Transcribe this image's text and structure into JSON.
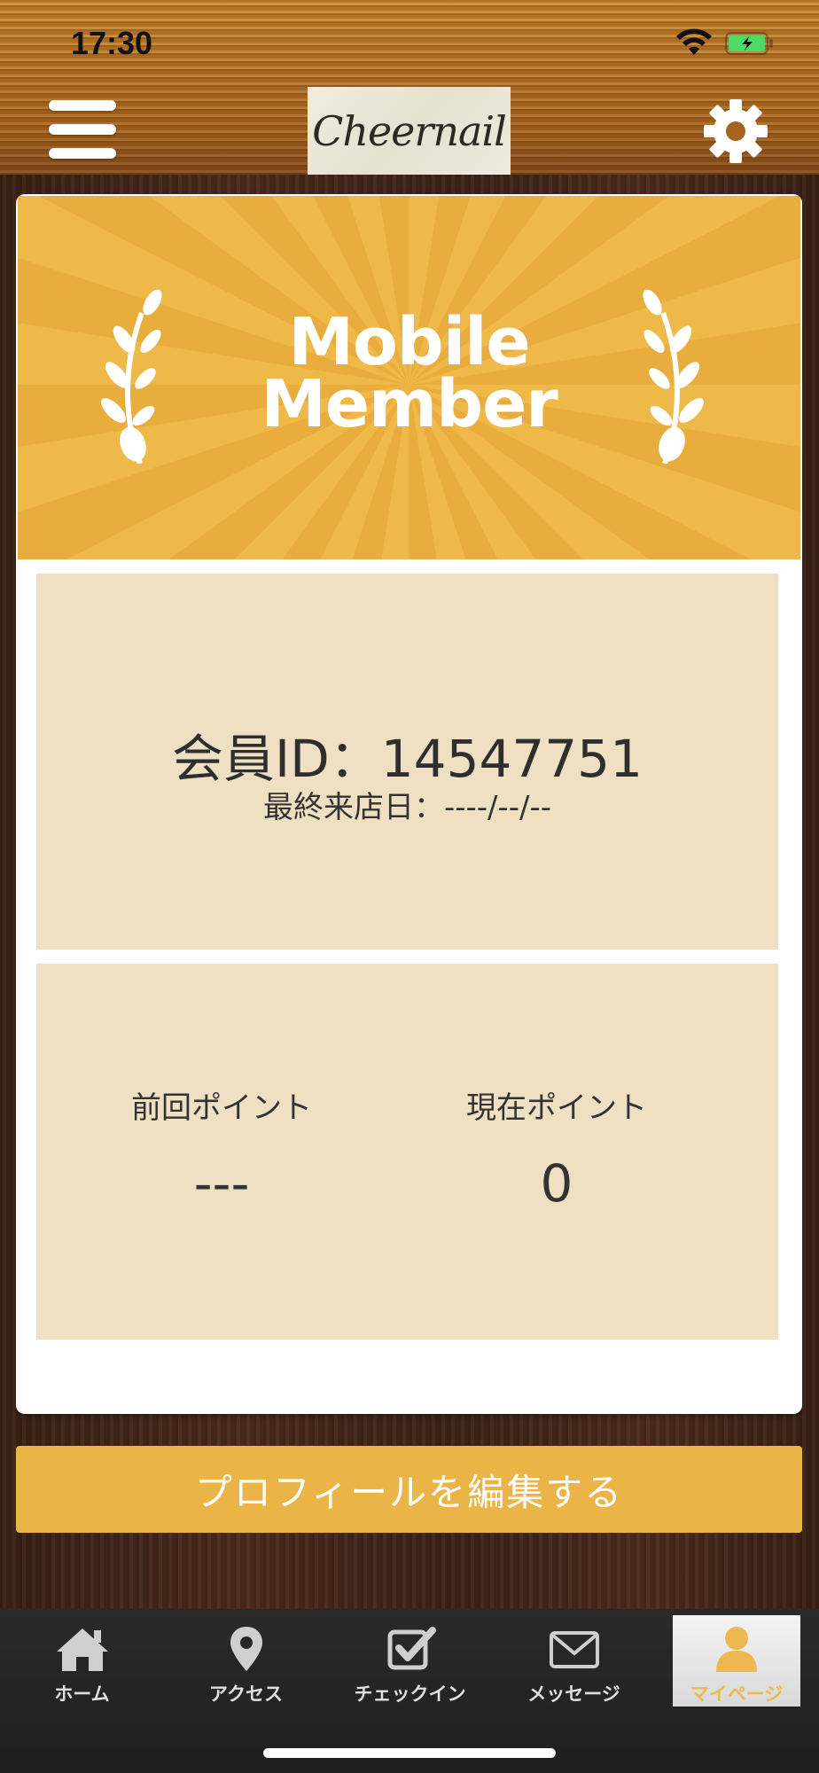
{
  "status_bar": {
    "time": "17:30"
  },
  "header": {
    "logo_text": "Cheernail",
    "menu_icon": "hamburger-menu-icon",
    "settings_icon": "gear-icon"
  },
  "member_card": {
    "banner_title_line1": "Mobile",
    "banner_title_line2": "Member",
    "member_id": "会員ID：14547751",
    "last_visit": "最終来店日：----/--/--",
    "previous_points_label": "前回ポイント",
    "previous_points_value": "---",
    "current_points_label": "現在ポイント",
    "current_points_value": "0"
  },
  "edit_profile_label": "プロフィールを編集する",
  "tabbar": {
    "items": [
      {
        "label": "ホーム",
        "icon": "home-icon"
      },
      {
        "label": "アクセス",
        "icon": "map-pin-icon"
      },
      {
        "label": "チェックイン",
        "icon": "checkbox-icon"
      },
      {
        "label": "メッセージ",
        "icon": "envelope-icon"
      },
      {
        "label": "マイページ",
        "icon": "user-icon",
        "active": true
      }
    ]
  },
  "colors": {
    "accent": "#ebb447",
    "panel": "#efe0c3",
    "active_tab_label": "#eeb850"
  }
}
